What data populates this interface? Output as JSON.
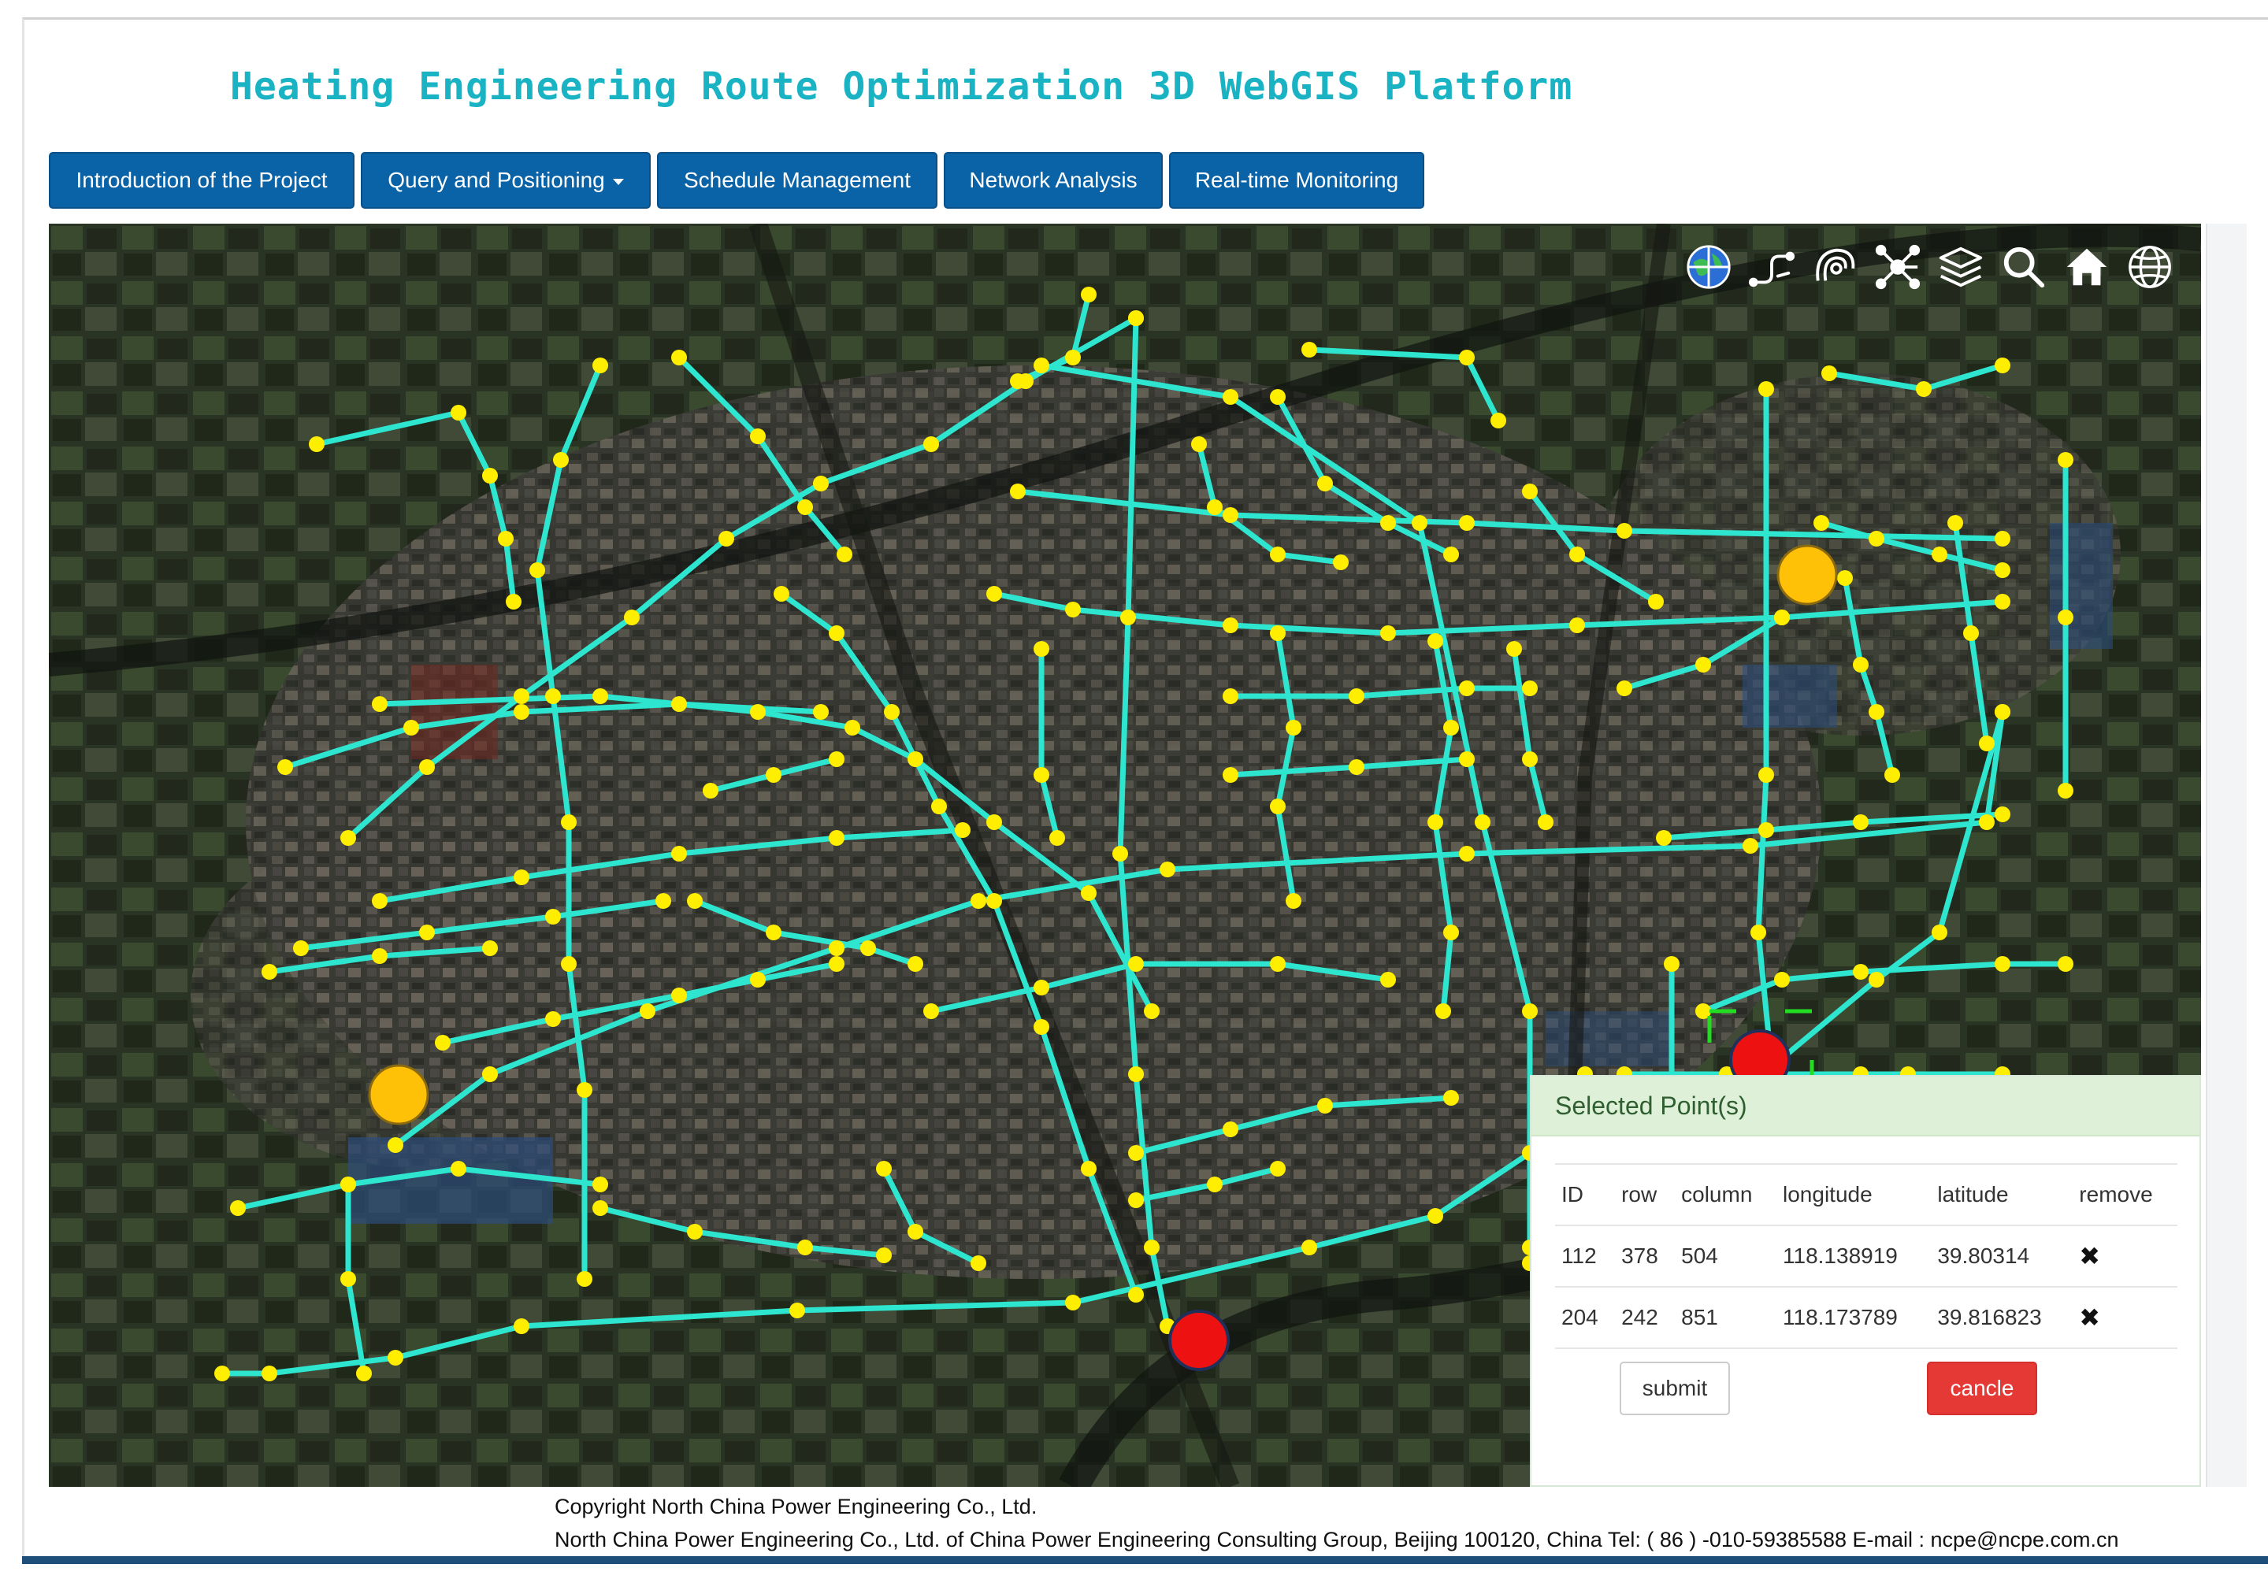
{
  "header": {
    "title": "Heating Engineering Route Optimization 3D WebGIS Platform"
  },
  "nav": {
    "items": [
      {
        "label": "Introduction of the Project",
        "dropdown": false
      },
      {
        "label": "Query and Positioning",
        "dropdown": true
      },
      {
        "label": "Schedule Management",
        "dropdown": false
      },
      {
        "label": "Network Analysis",
        "dropdown": false
      },
      {
        "label": "Real-time Monitoring",
        "dropdown": false
      }
    ]
  },
  "toolbar": {
    "icons": [
      "globe-grid-icon",
      "pipeline-icon",
      "buffer-icon",
      "network-node-icon",
      "layers-icon",
      "search-icon",
      "home-icon",
      "globe-icon"
    ]
  },
  "map": {
    "colors": {
      "pipe": "#2ee6cf",
      "node": "#ffee00",
      "heat_source": "#ffc107",
      "selected_point": "#ee1111",
      "selection_box": "#22dd22"
    }
  },
  "panel": {
    "title": "Selected Point(s)",
    "columns": [
      "ID",
      "row",
      "column",
      "longitude",
      "latitude",
      "remove"
    ],
    "rows": [
      {
        "id": "112",
        "row": "378",
        "column": "504",
        "longitude": "118.138919",
        "latitude": "39.80314",
        "remove": "✖"
      },
      {
        "id": "204",
        "row": "242",
        "column": "851",
        "longitude": "118.173789",
        "latitude": "39.816823",
        "remove": "✖"
      }
    ],
    "submit_label": "submit",
    "cancel_label": "cancle"
  },
  "footer": {
    "line1": "Copyright North China Power Engineering Co., Ltd.",
    "line2": "North China Power Engineering Co., Ltd. of China Power Engineering Consulting Group, Beijing 100120, China Tel: ( 86 ) -010-59385588 E-mail : ncpe@ncpe.com.cn"
  }
}
